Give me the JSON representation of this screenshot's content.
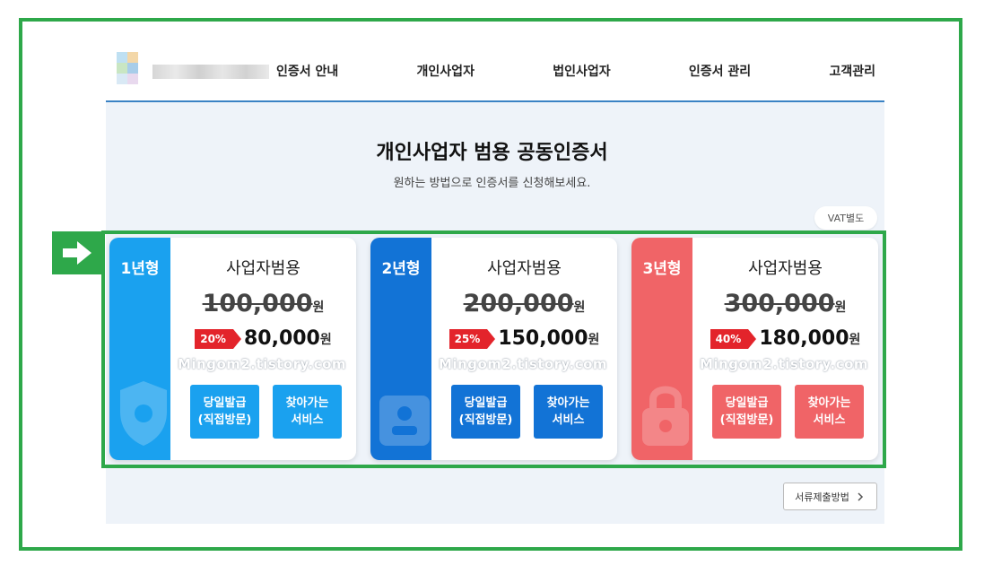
{
  "nav": {
    "items": [
      "인증서 안내",
      "개인사업자",
      "법인사업자",
      "인증서 관리",
      "고객관리"
    ]
  },
  "hero": {
    "title": "개인사업자 범용 공동인증서",
    "subtitle": "원하는 방법으로 인증서를 신청해보세요."
  },
  "vat_label": "VAT별도",
  "watermark": "Mingom2.tistory.com",
  "currency": "원",
  "cards": [
    {
      "tag": "1년형",
      "product": "사업자범용",
      "original": "100,000",
      "discount": "20%",
      "price": "80,000",
      "btn1": [
        "당일발급",
        "(직접방문)"
      ],
      "btn2": [
        "찾아가는",
        "서비스"
      ],
      "color": "#1aa1ef"
    },
    {
      "tag": "2년형",
      "product": "사업자범용",
      "original": "200,000",
      "discount": "25%",
      "price": "150,000",
      "btn1": [
        "당일발급",
        "(직접방문)"
      ],
      "btn2": [
        "찾아가는",
        "서비스"
      ],
      "color": "#1273d6"
    },
    {
      "tag": "3년형",
      "product": "사업자범용",
      "original": "300,000",
      "discount": "40%",
      "price": "180,000",
      "btn1": [
        "당일발급",
        "(직접방문)"
      ],
      "btn2": [
        "찾아가는",
        "서비스"
      ],
      "color": "#f06467"
    }
  ],
  "doc_button": "서류제출방법",
  "icons": {
    "arrow": "arrow-right-icon",
    "chevron": "chevron-right-icon"
  },
  "colors": {
    "highlight": "#2ea84a",
    "header_line": "#3a82c4",
    "badge": "#e3242b"
  }
}
